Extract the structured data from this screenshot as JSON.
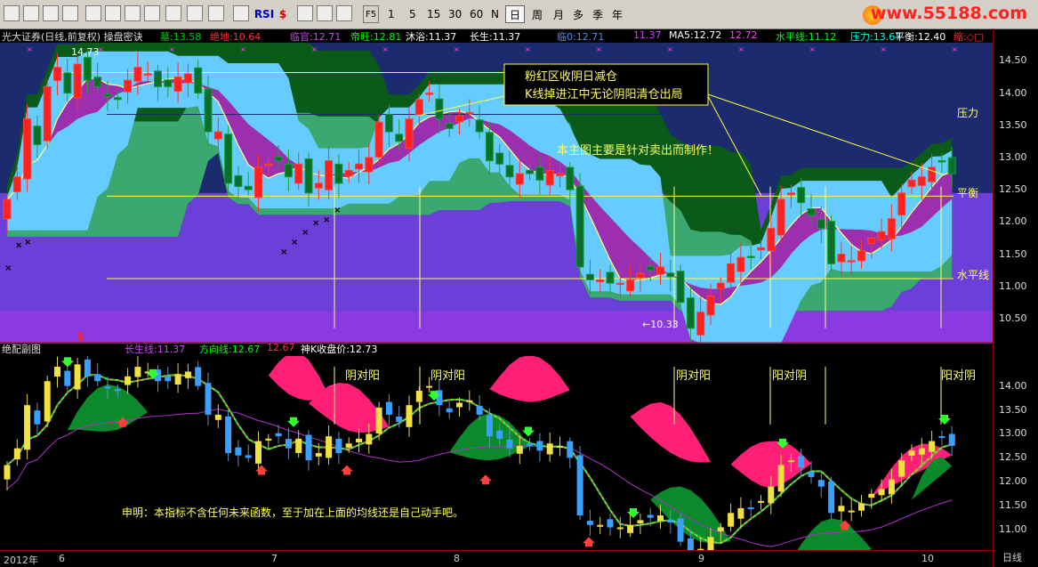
{
  "toolbar": {
    "periods": [
      "1",
      "5",
      "15",
      "30",
      "60",
      "N",
      "日",
      "周",
      "月",
      "多",
      "季",
      "年"
    ],
    "active_period": "日",
    "buttons": [
      "F5",
      "RSI",
      "$"
    ],
    "site_url": "www.55188.com"
  },
  "main_info": {
    "title": "光大证券(日线,前复权) 操盘密诀",
    "items": [
      {
        "label": "墓:",
        "value": "13.58",
        "color": "#00d000"
      },
      {
        "label": "绝地:",
        "value": "10.64",
        "color": "#ff3030"
      },
      {
        "label": "临官:",
        "value": "12.71",
        "color": "#d040ff"
      },
      {
        "label": "帝旺:",
        "value": "12.81",
        "color": "#00ff00"
      },
      {
        "label": "沐浴:",
        "value": "11.37",
        "color": "#ffffff"
      },
      {
        "label": "长生:",
        "value": "11.37",
        "color": "#ffffff"
      },
      {
        "label": "临0:",
        "value": "12.71",
        "color": "#4f8fff"
      },
      {
        "label": "",
        "value": "11.37",
        "color": "#d040ff"
      },
      {
        "label": "MA5:",
        "value": "12.72",
        "color": "#ffffff"
      },
      {
        "label": "",
        "value": "12.72",
        "color": "#ff40ff"
      },
      {
        "label": "水平线:",
        "value": "11.12",
        "color": "#00ff00"
      },
      {
        "label": "压力:",
        "value": "13.67",
        "color": "#00ffff"
      },
      {
        "label": "平衡:",
        "value": "12.40",
        "color": "#ffffff"
      },
      {
        "label": "缩:",
        "value": "◇□",
        "color": "#ff3030"
      }
    ]
  },
  "annotations": {
    "box_line1": "粉红区收阴日减仓",
    "box_line2": "K线掉进江中无论阴阳清仓出局",
    "main_note": "本主图主要是针对卖出而制作！",
    "pressure": "压力",
    "balance": "平衡",
    "horizontal": "水平线",
    "high_mark": "14.73",
    "low_mark": "←10.33",
    "sub_note": "申明：本指标不含任何未来函数，至于加在上面的均线还是自己动手吧。",
    "yin_yang_1": "阴对阳",
    "yin_yang_2": "阴对阳",
    "yang_yin_1": "阴对阳",
    "yang_yin_2": "阳对阴",
    "yang_yin_3": "阳对阴"
  },
  "sub_info": {
    "title": "绝配副图",
    "items": [
      {
        "label": "长生线:",
        "value": "11.37",
        "color": "#d040ff"
      },
      {
        "label": "方向线:",
        "value": "12.67",
        "color": "#00ff00"
      },
      {
        "label": "",
        "value": "12.67",
        "color": "#ff3030"
      },
      {
        "label": "神K收盘价:",
        "value": "12.73",
        "color": "#ffffff"
      }
    ]
  },
  "main_axis": [
    "14.50",
    "14.00",
    "13.50",
    "13.00",
    "12.50",
    "12.00",
    "11.50",
    "11.00",
    "10.50"
  ],
  "sub_axis": [
    "14.00",
    "13.50",
    "13.00",
    "12.50",
    "12.00",
    "11.50",
    "11.00"
  ],
  "date_axis": [
    "2012年",
    "6",
    "7",
    "8",
    "9",
    "10"
  ],
  "date_axis_period": "日线",
  "colors": {
    "up": "#ff2a2a",
    "down": "#00a0a0",
    "pink": "#ff1f77",
    "green_band": "#008a2a"
  },
  "chart_data": {
    "type": "candlestick",
    "closes": [
      12.35,
      12.7,
      13.6,
      13.2,
      14.1,
      14.4,
      14.0,
      14.45,
      14.2,
      14.1,
      13.95,
      13.9,
      14.2,
      14.4,
      14.3,
      14.1,
      14.1,
      14.25,
      14.3,
      14.0,
      13.4,
      13.4,
      12.6,
      12.55,
      12.5,
      12.85,
      12.9,
      12.95,
      12.7,
      12.9,
      12.45,
      12.6,
      12.95,
      12.6,
      12.8,
      12.9,
      13.0,
      13.55,
      13.4,
      13.25,
      13.6,
      13.9,
      14.0,
      13.6,
      13.45,
      13.65,
      13.7,
      13.4,
      12.95,
      12.9,
      12.7,
      12.75,
      12.75,
      12.65,
      12.8,
      12.75,
      12.5,
      11.3,
      11.1,
      11.1,
      11.05,
      11.05,
      11.1,
      11.2,
      11.25,
      11.3,
      11.15,
      10.75,
      10.35,
      10.6,
      10.85,
      11.05,
      11.35,
      11.45,
      11.45,
      11.6,
      11.9,
      12.35,
      12.45,
      12.3,
      12.1,
      11.9,
      11.35,
      11.5,
      11.4,
      11.55,
      11.75,
      11.85,
      12.05,
      12.45,
      12.65,
      12.7,
      12.85,
      12.95,
      12.75
    ],
    "y_range_main": [
      10.25,
      14.7
    ],
    "y_range_sub": [
      10.65,
      14.55
    ]
  }
}
